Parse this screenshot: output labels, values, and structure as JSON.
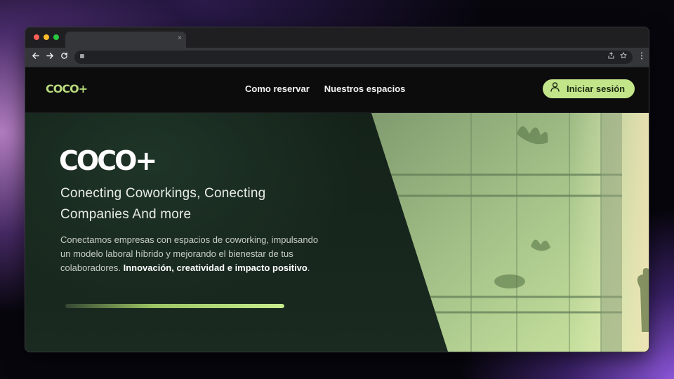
{
  "browser": {
    "tab_close": "×",
    "back_icon": "arrow-left-icon",
    "forward_icon": "arrow-right-icon",
    "reload_icon": "reload-icon",
    "traffic_colors": [
      "#ff5f57",
      "#febc2e",
      "#28c840"
    ]
  },
  "header": {
    "logo": "COCO+",
    "nav": [
      "Como reservar",
      "Nuestros espacios"
    ],
    "login_label": "Iniciar sesión",
    "login_icon": "user-icon"
  },
  "hero": {
    "logo": "COCO+",
    "title_line1": "Conecting Coworkings, Conecting",
    "title_line2": "Companies And more",
    "desc_plain": "Conectamos empresas con espacios de coworking, impulsando un modelo laboral híbrido y mejorando el bienestar de tus colaboradores. ",
    "desc_bold": "Innovación, creatividad e impacto positivo",
    "desc_end": ".",
    "progress": 1.0
  },
  "colors": {
    "accent": "#c2e58a",
    "logo_green": "#b9db7c",
    "header_bg": "#0c0c0d",
    "hero_bg": "#172a1f"
  }
}
